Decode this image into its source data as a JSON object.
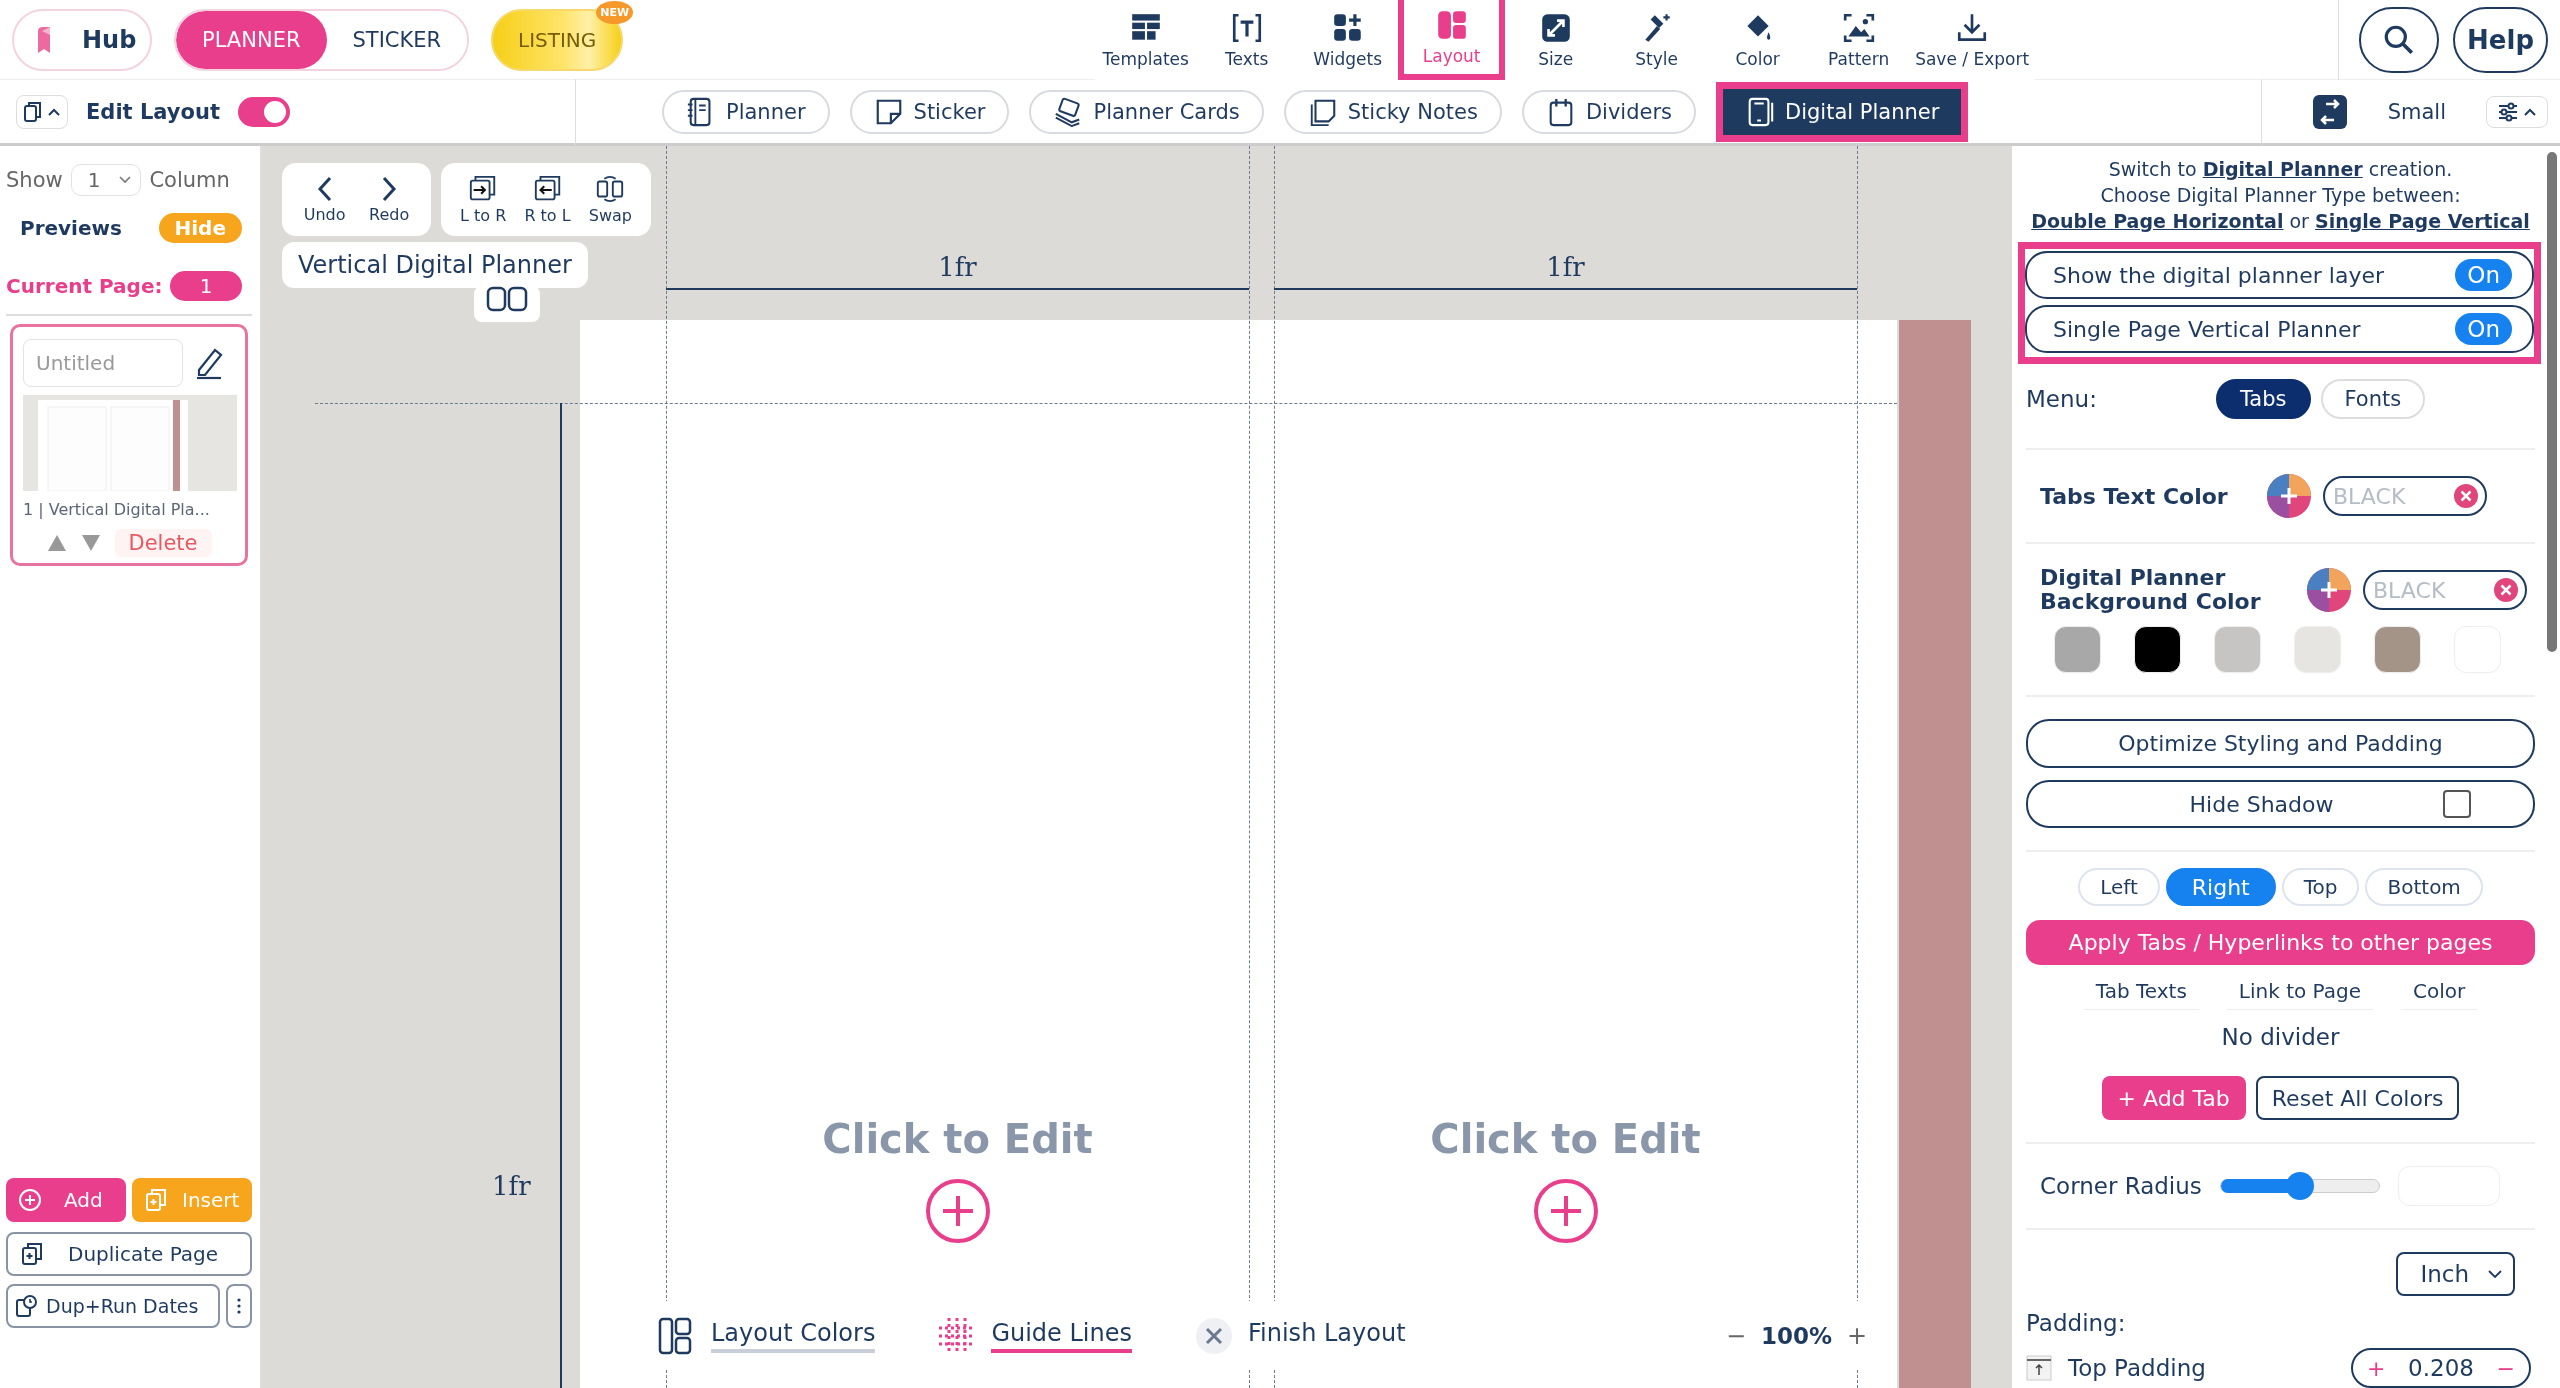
{
  "app_bar": {
    "hub": "Hub",
    "modes": [
      {
        "label": "PLANNER",
        "selected": true
      },
      {
        "label": "STICKER",
        "selected": false
      }
    ],
    "listing": {
      "label": "LISTING",
      "badge": "NEW"
    },
    "help": "Help"
  },
  "tools": [
    {
      "label": "Templates",
      "kind": "templates",
      "selected": false
    },
    {
      "label": "Texts",
      "kind": "texts",
      "selected": false
    },
    {
      "label": "Widgets",
      "kind": "widgets",
      "selected": false
    },
    {
      "label": "Layout",
      "kind": "layout",
      "selected": true
    },
    {
      "label": "Size",
      "kind": "size",
      "selected": false
    },
    {
      "label": "Style",
      "kind": "style",
      "selected": false
    },
    {
      "label": "Color",
      "kind": "color",
      "selected": false
    },
    {
      "label": "Pattern",
      "kind": "pattern",
      "selected": false
    },
    {
      "label": "Save / Export",
      "kind": "save",
      "selected": false
    }
  ],
  "edit_layout": {
    "label": "Edit Layout",
    "on": true
  },
  "product_tabs": [
    {
      "label": "Planner",
      "kind": "planner",
      "selected": false
    },
    {
      "label": "Sticker",
      "kind": "sticker",
      "selected": false
    },
    {
      "label": "Planner Cards",
      "kind": "cards",
      "selected": false
    },
    {
      "label": "Sticky Notes",
      "kind": "notes",
      "selected": false
    },
    {
      "label": "Dividers",
      "kind": "dividers",
      "selected": false
    },
    {
      "label": "Digital Planner",
      "kind": "digital",
      "selected": true
    }
  ],
  "size_label": "Small",
  "sidebar": {
    "show_label": "Show",
    "columns": "1",
    "column_label": "Column",
    "previews_label": "Previews",
    "hide_button": "Hide",
    "current_page_label": "Current Page:",
    "current_page": "1",
    "pages": [
      {
        "placeholder": "Untitled",
        "caption": "1 | Vertical Digital Pla...",
        "delete": "Delete",
        "selected": true
      }
    ],
    "add": "Add",
    "insert": "Insert",
    "duplicate": "Duplicate Page",
    "dup_run": "Dup+Run Dates"
  },
  "canvas": {
    "undo": "Undo",
    "redo": "Redo",
    "arrange": [
      {
        "label": "L to R",
        "kind": "ltr"
      },
      {
        "label": "R to L",
        "kind": "rtl"
      },
      {
        "label": "Swap",
        "kind": "swap"
      }
    ],
    "layout_name": "Vertical Digital Planner",
    "column_labels": [
      "1fr",
      "1fr"
    ],
    "row_label": "1fr",
    "cells": [
      {
        "text": "Click to Edit"
      },
      {
        "text": "Click to Edit"
      }
    ],
    "bottom_tools": [
      {
        "label": "Layout Colors",
        "kind": "colors",
        "selected": false
      },
      {
        "label": "Guide Lines",
        "kind": "guides",
        "selected": true
      },
      {
        "label": "Finish Layout",
        "kind": "finish",
        "selected": false
      }
    ],
    "zoom": {
      "minus": "−",
      "value": "100%",
      "plus": "+"
    }
  },
  "panel": {
    "intro": [
      [
        {
          "kind": "text",
          "text": "Switch to "
        },
        {
          "kind": "link",
          "text": "Digital Planner"
        },
        {
          "kind": "text",
          "text": " creation."
        }
      ],
      [
        {
          "kind": "text",
          "text": "Choose Digital Planner Type between:"
        }
      ],
      [
        {
          "kind": "link",
          "text": "Double Page Horizontal"
        },
        {
          "kind": "text",
          "text": " or "
        },
        {
          "kind": "link",
          "text": "Single Page Vertical"
        }
      ]
    ],
    "toggles": [
      {
        "label": "Show the digital planner layer",
        "value": "On",
        "on": true
      },
      {
        "label": "Single Page Vertical Planner",
        "value": "On",
        "on": true
      }
    ],
    "menu": {
      "label": "Menu:",
      "options": [
        {
          "label": "Tabs",
          "selected": true
        },
        {
          "label": "Fonts",
          "selected": false
        }
      ]
    },
    "text_color": {
      "label": "Tabs Text Color",
      "placeholder": "BLACK"
    },
    "bg_color": {
      "label": "Digital Planner Background Color",
      "placeholder": "BLACK",
      "swatches": [
        {
          "color": "#a8a8a8"
        },
        {
          "color": "#000000"
        },
        {
          "color": "#c6c5c3"
        },
        {
          "color": "#e6e5e2"
        },
        {
          "color": "#a39487"
        },
        {
          "color": "#ffffff"
        }
      ]
    },
    "optimize": "Optimize Styling and Padding",
    "hide_shadow": {
      "label": "Hide Shadow",
      "checked": false
    },
    "positions": [
      {
        "label": "Left",
        "selected": false
      },
      {
        "label": "Right",
        "selected": true
      },
      {
        "label": "Top",
        "selected": false
      },
      {
        "label": "Bottom",
        "selected": false
      }
    ],
    "apply": "Apply Tabs / Hyperlinks to other pages",
    "table_headers": [
      "Tab Texts",
      "Link to Page",
      "Color"
    ],
    "empty_text": "No divider",
    "add_tab": "+ Add Tab",
    "reset": "Reset All Colors",
    "corner_radius": {
      "label": "Corner Radius",
      "level": 0.5
    },
    "unit": "Inch",
    "padding_label": "Padding:",
    "padding_rows": [
      {
        "label": "Top Padding",
        "plus": "+",
        "value": "0.208",
        "minus": "−"
      }
    ]
  }
}
